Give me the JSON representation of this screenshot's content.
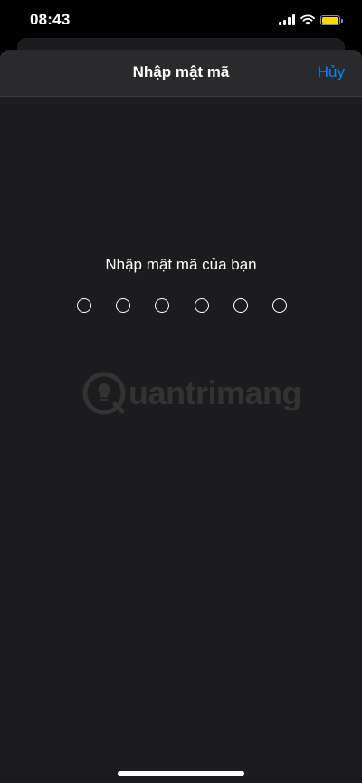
{
  "status_bar": {
    "time": "08:43",
    "battery_color": "#ffd60a"
  },
  "nav": {
    "title": "Nhập mật mã",
    "cancel_label": "Hủy",
    "accent_color": "#0a84ff"
  },
  "passcode": {
    "prompt": "Nhập mật mã của bạn",
    "digits_total": 6,
    "digits_entered": 0
  },
  "watermark": {
    "text": "uantrimang",
    "icon": "lightbulb-icon"
  }
}
